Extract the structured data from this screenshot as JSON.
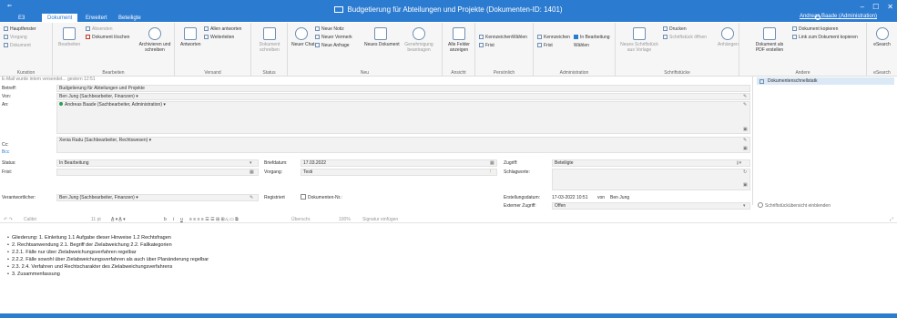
{
  "window": {
    "title": "Budgetierung für Abteilungen und Projekte (Dokumenten-ID: 1401)",
    "qat_glyph": "⇐",
    "controls": {
      "minimize": "‒",
      "maximize": "☐",
      "close": "✕"
    }
  },
  "tabs": [
    {
      "label": "E3"
    },
    {
      "label": "Dokument"
    },
    {
      "label": "Erweitert"
    },
    {
      "label": "Beteiligte"
    }
  ],
  "user": {
    "label": "Andreas Baade (Administration)"
  },
  "ribbon": {
    "kunstion": {
      "label": "Kunstion",
      "items": [
        "Hauptfenster",
        "Vorgang",
        "Dokument"
      ]
    },
    "bearbeiten": {
      "label": "Bearbeiten",
      "items": [
        "Bearbeiten",
        "Absenden",
        "Dokument löschen",
        "Archivieren und schreiben"
      ]
    },
    "versand": {
      "label": "Versand",
      "items": [
        "Antworten",
        "Allen antworten",
        "Weiterleiten"
      ]
    },
    "status": {
      "label": "Status",
      "items": [
        "Dokument schreiben"
      ]
    },
    "neu": {
      "label": "Neu",
      "items": [
        "Neuer Chat",
        "Neue Notiz",
        "Neuer Vermerk",
        "Neue Anfrage",
        "Neues Dokument",
        "Genehmigung beantragen"
      ]
    },
    "ansicht": {
      "label": "Ansicht",
      "items": [
        "Alle Felder anzeigen"
      ]
    },
    "persoenlich": {
      "label": "Persönlich",
      "items": [
        "Kennzeichen",
        "Wählen",
        "Frist"
      ]
    },
    "administration": {
      "label": "Administration",
      "items": [
        "Kennzeichen",
        "Wählen",
        "In Bearbeitung",
        "Frist",
        "Wählen"
      ]
    },
    "schriftstuecke": {
      "label": "Schriftstücke",
      "items": [
        "Neues Schriftstück aus Vorlage",
        "Schriftstück öffnen",
        "Drucken",
        "Anhängen"
      ]
    },
    "andere": {
      "label": "Andere",
      "items": [
        "Dokument als PDF erstellen",
        "Dokument kopieren",
        "Link zum Dokument kopieren"
      ]
    },
    "esearch": {
      "label": "eSearch",
      "items": [
        "eSearch"
      ]
    }
  },
  "meta_line": "E-Mail wurde intern versendet... gestern 12:51",
  "side_pane": {
    "item": "Dokumentenschnellstatk"
  },
  "form": {
    "betreff": {
      "label": "Betreff:",
      "value": "Budgetierung für Abteilungen und Projekte"
    },
    "von": {
      "label": "Von:",
      "value": "Ben Jung (Sachbearbeiter, Finanzen) ▾"
    },
    "an": {
      "label": "An:",
      "value": "Andreas Baade (Sachbearbeiter, Administration) ▾"
    },
    "cc": {
      "label": "Cc:",
      "value": "Xenia Radu (Sachbearbeiter, Rechtswesen) ▾"
    },
    "bcc": {
      "label": "Bcc"
    },
    "status": {
      "label": "Status:",
      "value": "In Bearbeitung"
    },
    "frist": {
      "label": "Frist:",
      "value": ""
    },
    "briefdatum": {
      "label": "Briefdatum:",
      "value": "17.03.2022"
    },
    "vorgang": {
      "label": "Vorgang:",
      "value": "Testi"
    },
    "zugriff": {
      "label": "Zugriff:",
      "value": "Beteiligte"
    },
    "schlagworte": {
      "label": "Schlagworte:",
      "value": ""
    },
    "verantwortlicher": {
      "label": "Verantwortlicher:",
      "value": "Ben Jung (Sachbearbeiter, Finanzen) ▾"
    },
    "registriert": {
      "label": "Registriert",
      "checkbox_label": "Dokumenten-Nr.:"
    },
    "erstellungsdatum": {
      "label": "Erstellungsdatum:",
      "value": "17-03-2022 10:51",
      "von_label": "von",
      "von_value": "Ben Jung"
    },
    "externer_zugriff": {
      "label": "Externer Zugriff:",
      "value": "Offen"
    },
    "schriftstueck_toggle": "Schriftstückübersicht einblenden"
  },
  "format_bar": {
    "font": "Calibri",
    "size": "11 pt",
    "style": "Überschr.",
    "zoom": "100%",
    "signature": "Signatur einfügen"
  },
  "body_lines": [
    "Gliederung: 1. Einleitung 1.1 Aufgabe dieser Hinweise 1.2 Rechtsfragen",
    "2. Rechtsanwendung 2.1. Begriff der Zielabweichung 2.2. Fallkategorien",
    "2.2.1. Fälle nur über Zielabweichungsverfahren regelbar",
    "2.2.2. Fälle sowohl über Zielabweichungsverfahren als auch über Planänderung regelbar",
    "2.3. 2.4. Verfahren und Rechtscharakter des Zielabweichungsverfahrens",
    "3. Zusammenfassung"
  ],
  "colors": {
    "accent": "#2b7bd1",
    "field_bg": "#f2f2f2",
    "side_selected": "#dbe8f6"
  }
}
